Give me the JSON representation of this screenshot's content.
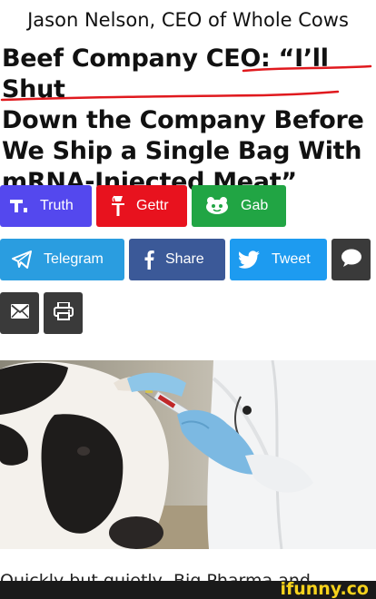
{
  "caption": "Jason Nelson, CEO of Whole Cows",
  "headline": {
    "line1": "Beef Company CEO: “I’ll Shut",
    "line2": "Down the Company Before",
    "line3": "We Ship a Single Bag With",
    "line4": "mRNA-Injected Meat”"
  },
  "share_buttons": {
    "truth": "Truth",
    "gettr": "Gettr",
    "gab": "Gab",
    "telegram": "Telegram",
    "share": "Share",
    "tweet": "Tweet"
  },
  "colors": {
    "truth": "#5448ee",
    "gettr": "#e8121e",
    "gab": "#21a544",
    "telegram": "#2a9de0",
    "facebook": "#3b5998",
    "twitter": "#1d9bf0",
    "dark": "#3a3a3a",
    "underline": "#e0191e",
    "watermark": "#f6d21c"
  },
  "icons": [
    "truth-icon",
    "gettr-icon",
    "gab-icon",
    "telegram-icon",
    "facebook-icon",
    "twitter-icon",
    "sms-icon",
    "email-icon",
    "print-icon"
  ],
  "article_preview": "Quickly but quietly, Big Pharma and",
  "watermark": "ifunny.co"
}
